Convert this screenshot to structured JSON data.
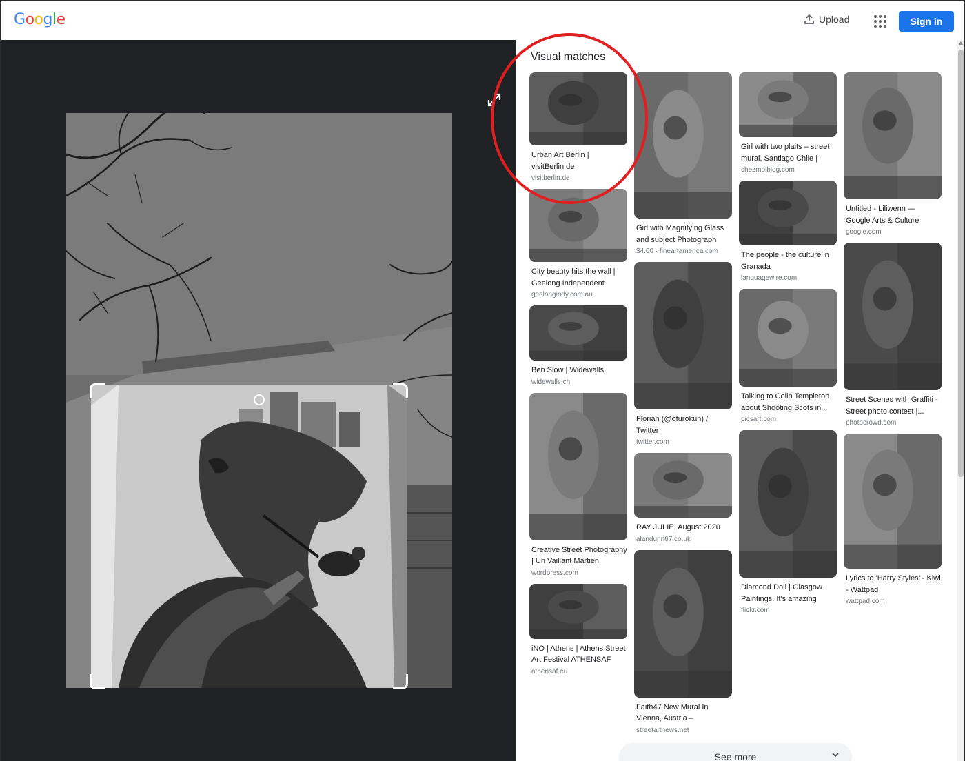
{
  "header": {
    "logo_text": "Google",
    "logo_colors": [
      "#4285F4",
      "#EA4335",
      "#FBBC05",
      "#4285F4",
      "#34A853",
      "#EA4335"
    ],
    "upload_label": "Upload",
    "apps_icon": "apps-grid-icon",
    "signin_label": "Sign in",
    "signin_color": "#1a73e8"
  },
  "main": {
    "section_title": "Visual matches",
    "see_more_label": "See more"
  },
  "annotation": {
    "shape": "circle",
    "color": "#e02020",
    "target": "Urban Art Berlin | visitBerlin.de"
  },
  "results": {
    "col1": [
      {
        "title": "Urban Art Berlin | visitBerlin.de",
        "source": "visitberlin.de"
      },
      {
        "title": "City beauty hits the wall | Geelong Independent",
        "source": "geelongindy.com.au"
      },
      {
        "title": "Ben Slow | Widewalls",
        "source": "widewalls.ch"
      },
      {
        "title": "Creative Street Photography | Un Vaillant Martien",
        "source": "wordpress.com"
      },
      {
        "title": "iNO | Athens | Athens Street Art Festival ATHENSAF",
        "source": "athensaf.eu"
      }
    ],
    "col2": [
      {
        "title": "Girl with Magnifying Glass and subject Photograph by...",
        "source": "$4.00 · fineartamerica.com"
      },
      {
        "title": "Florian (@ofurokun) / Twitter",
        "source": "twitter.com"
      },
      {
        "title": "RAY JULIE, August 2020",
        "source": "alandunn67.co.uk"
      },
      {
        "title": "Faith47 New Mural In Vienna, Austria – StreetArtNews",
        "source": "streetartnews.net"
      }
    ],
    "col3": [
      {
        "title": "Girl with two plaits – street mural, Santiago Chile | Chez...",
        "source": "chezmoiblog.com"
      },
      {
        "title": "The people - the culture in Granada",
        "source": "languagewire.com"
      },
      {
        "title": "Talking to Colin Templeton about Shooting Scots in...",
        "source": "picsart.com"
      },
      {
        "title": "Diamond Doll | Glasgow Paintings. It's amazing what...",
        "source": "flickr.com"
      }
    ],
    "col4": [
      {
        "title": "Untitled - Liliwenn — Google Arts & Culture",
        "source": "google.com"
      },
      {
        "title": "Street Scenes with Graffiti - Street photo contest |...",
        "source": "photocrowd.com"
      },
      {
        "title": "Lyrics to 'Harry Styles' - Kiwi - Wattpad",
        "source": "wattpad.com"
      }
    ]
  }
}
